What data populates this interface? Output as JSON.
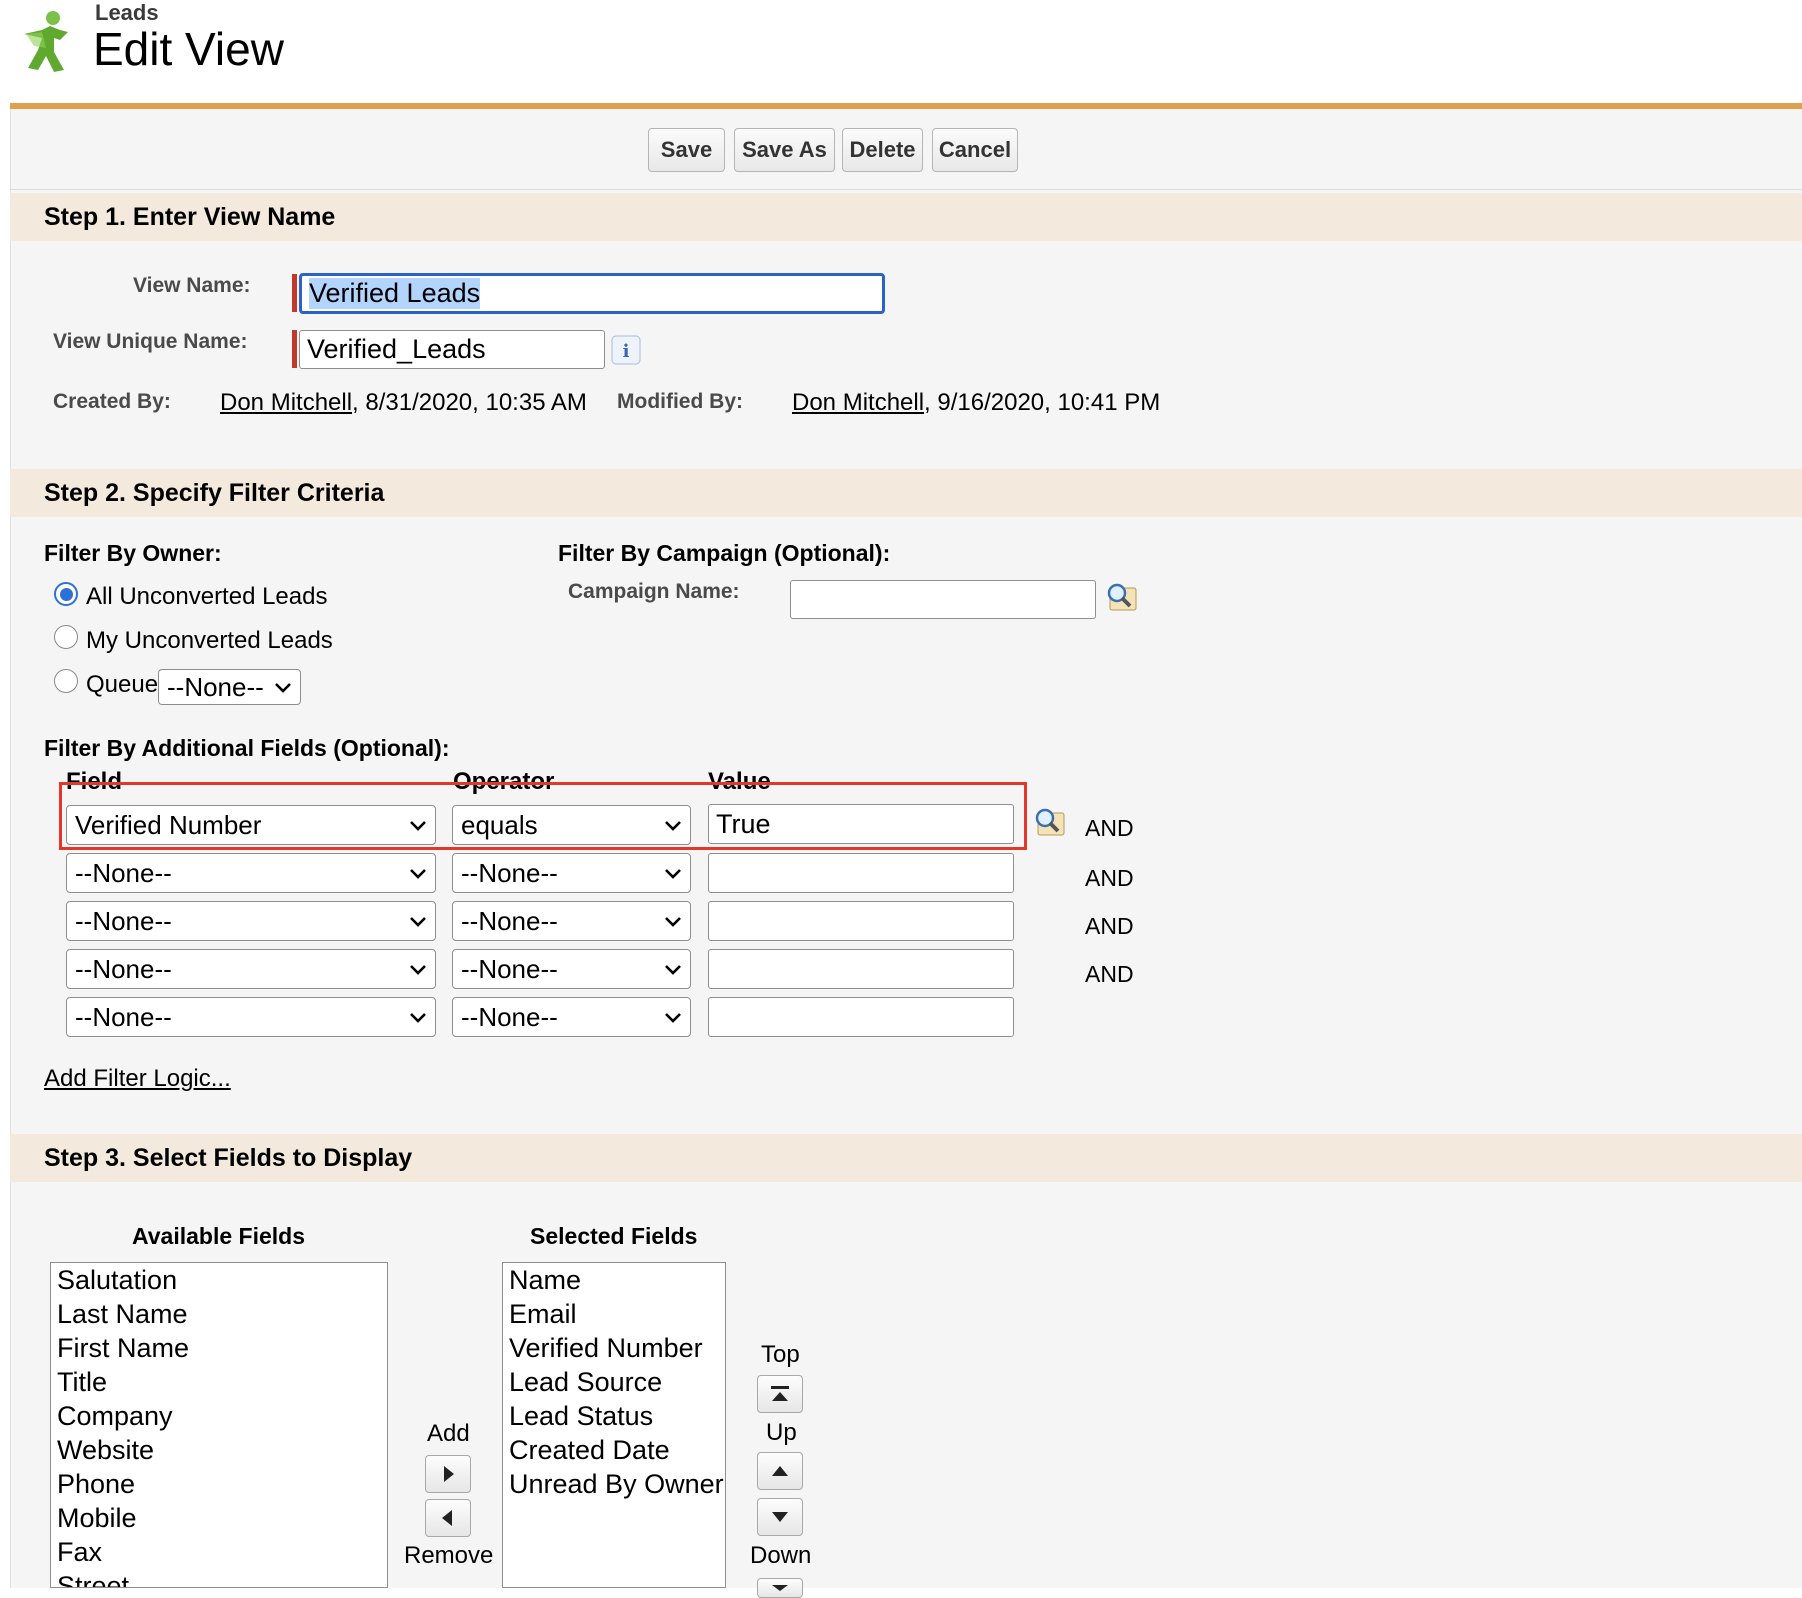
{
  "header": {
    "object_label": "Leads",
    "title": "Edit View"
  },
  "toolbar": {
    "save_label": "Save",
    "save_as_label": "Save As",
    "delete_label": "Delete",
    "cancel_label": "Cancel"
  },
  "step1": {
    "heading": "Step 1. Enter View Name",
    "view_name_label": "View Name:",
    "view_name_value": "Verified Leads",
    "unique_name_label": "View Unique Name:",
    "unique_name_value": "Verified_Leads",
    "created_by_label": "Created By:",
    "created_by_user": "Don Mitchell",
    "created_by_date": ", 8/31/2020, 10:35 AM",
    "modified_by_label": "Modified By:",
    "modified_by_user": "Don Mitchell",
    "modified_by_date": ", 9/16/2020, 10:41 PM"
  },
  "step2": {
    "heading": "Step 2. Specify Filter Criteria",
    "owner_label": "Filter By Owner:",
    "owner_options": [
      "All Unconverted Leads",
      "My Unconverted Leads",
      "Queue"
    ],
    "owner_selected": "All Unconverted Leads",
    "queue_value": "--None--",
    "campaign_label": "Filter By Campaign (Optional):",
    "campaign_name_label": "Campaign Name:",
    "campaign_name_value": "",
    "additional_label": "Filter By Additional Fields (Optional):",
    "col_field": "Field",
    "col_operator": "Operator",
    "col_value": "Value",
    "rows": [
      {
        "field": "Verified Number",
        "operator": "equals",
        "value": "True",
        "conjunction": "AND"
      },
      {
        "field": "--None--",
        "operator": "--None--",
        "value": "",
        "conjunction": "AND"
      },
      {
        "field": "--None--",
        "operator": "--None--",
        "value": "",
        "conjunction": "AND"
      },
      {
        "field": "--None--",
        "operator": "--None--",
        "value": "",
        "conjunction": "AND"
      },
      {
        "field": "--None--",
        "operator": "--None--",
        "value": "",
        "conjunction": ""
      }
    ],
    "filter_logic_link": "Add Filter Logic..."
  },
  "step3": {
    "heading": "Step 3. Select Fields to Display",
    "available_label": "Available Fields",
    "available_fields": [
      "Salutation",
      "Last Name",
      "First Name",
      "Title",
      "Company",
      "Website",
      "Phone",
      "Mobile",
      "Fax",
      "Street"
    ],
    "selected_label": "Selected Fields",
    "selected_fields": [
      "Name",
      "Email",
      "Verified Number",
      "Lead Source",
      "Lead Status",
      "Created Date",
      "Unread By Owner"
    ],
    "add_label": "Add",
    "remove_label": "Remove",
    "top_label": "Top",
    "up_label": "Up",
    "down_label": "Down"
  },
  "colors": {
    "accent_bar": "#e1a04a",
    "section_bg": "#f3e9dc",
    "focus_border": "#2b62c8",
    "required_marker": "#c0392b",
    "annotation_box": "#e5362b"
  },
  "icons": {
    "logo": "leads-figure-icon",
    "lookup": "magnifier-lookup-icon",
    "info": "info-icon"
  }
}
